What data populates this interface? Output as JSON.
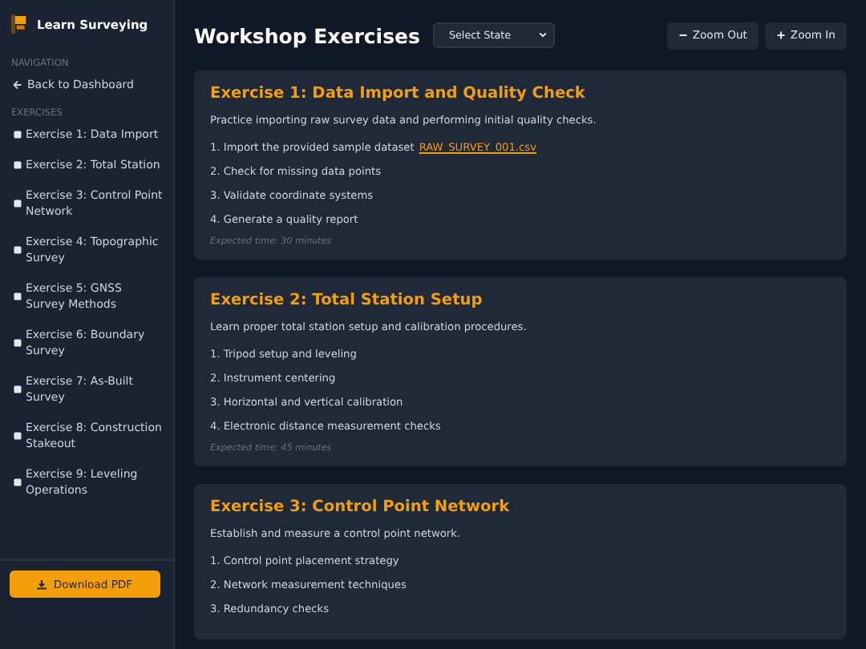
{
  "sidebar": {
    "title": "Learn Surveying",
    "sections": [
      {
        "label": "NAVIGATION",
        "items": [
          {
            "label": "Back to Dashboard",
            "kind": "back"
          }
        ]
      },
      {
        "label": "EXERCISES",
        "items": [
          {
            "label": "Exercise 1: Data Import",
            "kind": "exercise"
          },
          {
            "label": "Exercise 2: Total Station",
            "kind": "exercise"
          },
          {
            "label": "Exercise 3: Control Point Network",
            "kind": "exercise"
          },
          {
            "label": "Exercise 4: Topographic Survey",
            "kind": "exercise"
          },
          {
            "label": "Exercise 5: GNSS Survey Methods",
            "kind": "exercise"
          },
          {
            "label": "Exercise 6: Boundary Survey",
            "kind": "exercise"
          },
          {
            "label": "Exercise 7: As-Built Survey",
            "kind": "exercise"
          },
          {
            "label": "Exercise 8: Construction Stakeout",
            "kind": "exercise"
          },
          {
            "label": "Exercise 9: Leveling Operations",
            "kind": "exercise"
          }
        ]
      }
    ],
    "download_button": "Download PDF"
  },
  "header": {
    "title": "Workshop Exercises",
    "state_select": {
      "placeholder": "Select State"
    },
    "buttons": [
      "Zoom Out",
      "Zoom In"
    ]
  },
  "exercises": [
    {
      "title": "Exercise 1: Data Import and Quality Check",
      "description": "Practice importing raw survey data and performing initial quality checks.",
      "steps": [
        {
          "text": "1. Import the provided sample dataset",
          "link": "RAW_SURVEY_001.csv"
        },
        {
          "text": "2. Check for missing data points"
        },
        {
          "text": "3. Validate coordinate systems"
        },
        {
          "text": "4. Generate a quality report"
        }
      ],
      "time": "Expected time: 30 minutes"
    },
    {
      "title": "Exercise 2: Total Station Setup",
      "description": "Learn proper total station setup and calibration procedures.",
      "steps": [
        {
          "text": "1. Tripod setup and leveling"
        },
        {
          "text": "2. Instrument centering"
        },
        {
          "text": "3. Horizontal and vertical calibration"
        },
        {
          "text": "4. Electronic distance measurement checks"
        }
      ],
      "time": "Expected time: 45 minutes"
    },
    {
      "title": "Exercise 3: Control Point Network",
      "description": "Establish and measure a control point network.",
      "steps": [
        {
          "text": "1. Control point placement strategy"
        },
        {
          "text": "2. Network measurement techniques"
        },
        {
          "text": "3. Redundancy checks"
        }
      ]
    }
  ]
}
